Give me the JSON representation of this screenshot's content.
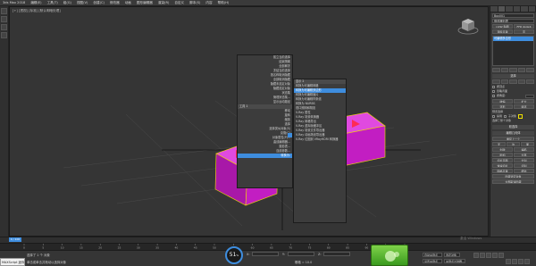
{
  "menubar": {
    "items": [
      "3ds Max 2018",
      "编辑(E)",
      "工具(T)",
      "组(G)",
      "视图(V)",
      "创建(C)",
      "修改器",
      "动画",
      "图形编辑器",
      "渲染(R)",
      "自定义",
      "脚本(S)",
      "内容",
      "帮助(H)"
    ]
  },
  "viewport": {
    "label": "[+] [透视] [标准] [默认明暗处理]"
  },
  "quad_left": {
    "items": [
      "孤立当前选择",
      "结束隔离",
      "全部解冻",
      "冻结当前选择",
      "按名称取消隐藏",
      "全部取消隐藏",
      "隐藏未选定对象",
      "隐藏选定对象",
      "状态集",
      "管理状态集...",
      "显示运动路径"
    ],
    "tools_header": "工具 1",
    "tools": [
      "移动",
      "旋转",
      "缩放",
      "选择",
      "选择类似对象(S)",
      "克隆(C)",
      "对象属性(P)...",
      "曲线编辑器...",
      "摄影表...",
      "连线参数...",
      "转换为:"
    ]
  },
  "quad_right": {
    "header": "显示 2",
    "items": [
      "视口照明和阴影",
      "V-Ray 属性",
      "V-Ray 场景转换器",
      "V-Ray 网格导出",
      "V-Ray 虚拟帧缓冲区",
      "V-Ray 场景文件导出器",
      "V-Ray 动画场景导出器",
      "V-Ray 位图到 VRayHDRI 转换器"
    ],
    "submenu": [
      "转换为可编辑网格",
      "转换为可编辑多边形",
      "转换为可编辑面片",
      "转换为可编辑样条线",
      "转换为 NURBS"
    ],
    "submenu_highlight": "转换为可编辑多边形"
  },
  "cmdpanel": {
    "object_name": "Box001",
    "modifier_list": "修改器列表",
    "buttons_row1": [
      "UVW 贴图",
      "FFD 4x4x4"
    ],
    "buttons_row2": [
      "涡轮平滑",
      "壳"
    ],
    "stack_item": "可编辑多边形",
    "section_select": "选择",
    "options": [
      "按顶点",
      "忽略背面",
      "按角度:",
      "收缩",
      "扩大",
      "环形",
      "循环"
    ],
    "angle_value": "45.0",
    "preview_label": "预览选择",
    "preview_options": [
      "禁用",
      "子对象",
      "多个"
    ],
    "selected_status": "选择了整个对象",
    "section_soft": "软选择",
    "section_edit": "编辑几何体",
    "edit_buttons": [
      "重复上一个",
      "约束",
      "无",
      "边",
      "面",
      "法线",
      "保持 UV",
      "创建",
      "塌陷",
      "附加",
      "分离",
      "切片平面",
      "分割",
      "切片",
      "重置平面",
      "快速切片",
      "切割",
      "网格平滑",
      "细化",
      "平面化",
      "视图对齐",
      "栅格对齐",
      "松弛",
      "隐藏选定对象",
      "全部取消隐藏",
      "隐藏未选定对象",
      "命名选择:",
      "复制",
      "粘贴",
      "删除孤立顶点"
    ]
  },
  "timeline": {
    "frame": "0 / 100",
    "ticks": [
      "0",
      "5",
      "10",
      "15",
      "20",
      "25",
      "30",
      "35",
      "40",
      "45",
      "50",
      "55",
      "60",
      "65",
      "70",
      "75",
      "80",
      "85",
      "90",
      "95",
      "100"
    ]
  },
  "status": {
    "line1": "选择了 1 个 对象",
    "line2": "单击或单击并拖动以选择对象",
    "maxscript": "MAXScript 迷你",
    "fps": "51",
    "fps_unit": "%",
    "x_label": "X:",
    "y_label": "Y:",
    "z_label": "Z:",
    "grid": "栅格 = 10.0",
    "add_time_tag": "添加时间标记",
    "autokey": "自动关键点",
    "set_key": "设置关键点",
    "selected": "选定对象",
    "key_filters": "关键点过滤器...",
    "activate_windows": "激活 Windows"
  },
  "colors": {
    "accent": "#3e8dde",
    "box_magenta": "#c21ec2",
    "selection_yellow": "#f0e000"
  }
}
